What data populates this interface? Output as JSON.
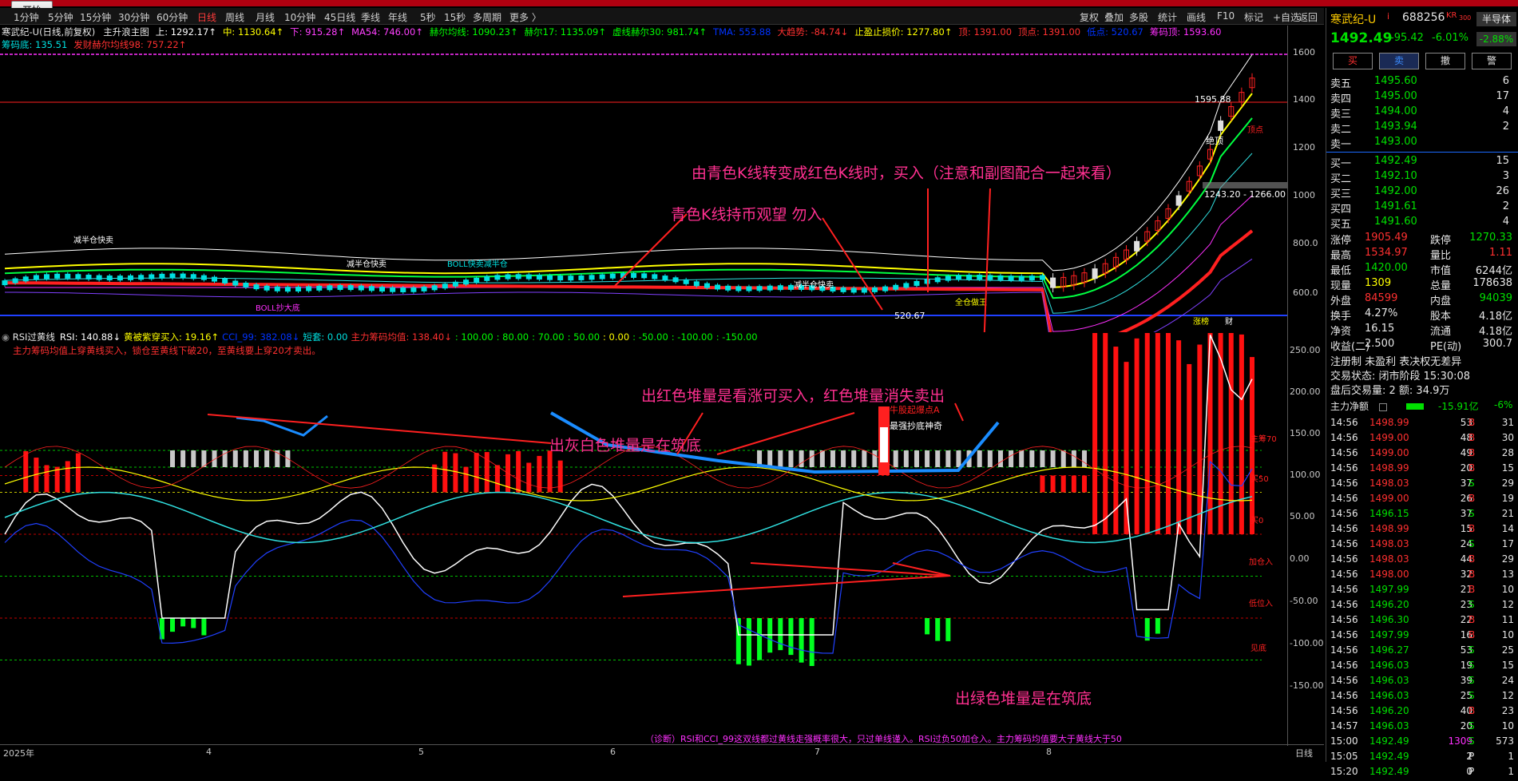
{
  "start_button": "开始",
  "periods": [
    {
      "label": "1分钟",
      "active": false
    },
    {
      "label": "5分钟",
      "active": false
    },
    {
      "label": "15分钟",
      "active": false
    },
    {
      "label": "30分钟",
      "active": false
    },
    {
      "label": "60分钟",
      "active": false
    },
    {
      "label": "日线",
      "active": true
    },
    {
      "label": "周线",
      "active": false
    },
    {
      "label": "月线",
      "active": false
    },
    {
      "label": "10分钟",
      "active": false
    },
    {
      "label": "45日线",
      "active": false
    },
    {
      "label": "季线",
      "active": false
    },
    {
      "label": "年线",
      "active": false
    },
    {
      "label": "5秒",
      "active": false
    },
    {
      "label": "15秒",
      "active": false
    },
    {
      "label": "多周期",
      "active": false
    },
    {
      "label": "更多 〉",
      "active": false
    }
  ],
  "tools": [
    "复权",
    "叠加",
    "多股",
    "统计",
    "画线",
    "F10",
    "标记",
    "+自选",
    "返回"
  ],
  "main_info": {
    "title": "寒武纪-U(日线,前复权)",
    "indicator": "主升浪主图",
    "items": [
      {
        "text": "上: 1292.17↑",
        "color": "#ffffff"
      },
      {
        "text": "中: 1130.64↑",
        "color": "#ffff00"
      },
      {
        "text": "下: 915.28↑",
        "color": "#ff40ff"
      },
      {
        "text": "MA54: 746.00↑",
        "color": "#ff40ff"
      },
      {
        "text": "赫尔均线: 1090.23↑",
        "color": "#00ff00"
      },
      {
        "text": "赫尔17: 1135.09↑",
        "color": "#00ff00"
      },
      {
        "text": "虚线赫尔30: 981.74↑",
        "color": "#00ff00"
      },
      {
        "text": "TMA: 553.88",
        "color": "#0033ff"
      },
      {
        "text": "大趋势: -84.74↓",
        "color": "#ff3030"
      },
      {
        "text": "止盈止损价: 1277.80↑",
        "color": "#ffff00"
      },
      {
        "text": "顶: 1391.00",
        "color": "#ff3030"
      },
      {
        "text": "顶点: 1391.00",
        "color": "#ff3030"
      },
      {
        "text": "低点: 520.67",
        "color": "#0033ff"
      },
      {
        "text": "筹码顶: 1593.60",
        "color": "#ff30ff"
      }
    ],
    "line2": [
      {
        "text": "筹码底: 135.51",
        "color": "#00e0e0"
      },
      {
        "text": "发财赫尔均线98: 757.22↑",
        "color": "#ff3030"
      }
    ]
  },
  "sub_info": {
    "title": "RSI过黄线",
    "items": [
      {
        "text": "RSI: 140.88↓",
        "color": "#ffffff"
      },
      {
        "text": "黄被紫穿买入: 19.16↑",
        "color": "#ffff00"
      },
      {
        "text": "CCI_99: 382.08↓",
        "color": "#0033ff"
      },
      {
        "text": "短套: 0.00",
        "color": "#00e0e0"
      },
      {
        "text": "主力筹码均值: 138.40↓",
        "color": "#ff3030"
      },
      {
        "text": ": 100.00",
        "color": "#00ff00"
      },
      {
        "text": ": 80.00",
        "color": "#00ff00"
      },
      {
        "text": ": 70.00",
        "color": "#00ff00"
      },
      {
        "text": ": 50.00",
        "color": "#00ff00"
      },
      {
        "text": ": 0.00",
        "color": "#ffff00"
      },
      {
        "text": ": -50.00",
        "color": "#00ff00"
      },
      {
        "text": ": -100.00",
        "color": "#00ff00"
      },
      {
        "text": ": -150.00",
        "color": "#00ff00"
      }
    ],
    "note": "主力筹码均值上穿黄线买入，锁仓至黄线下破20，至黄线要上穿20才卖出。"
  },
  "main_axis": [
    "1600",
    "1400",
    "1200",
    "1000",
    "800.0",
    "600.0"
  ],
  "sub_axis": [
    "250.00",
    "200.00",
    "150.00",
    "100.00",
    "50.00",
    "0.00",
    "-50.00",
    "-100.00",
    "-150.00"
  ],
  "sub_right_labels": [
    "主筹70",
    "买50",
    "买0",
    "加仓入",
    "低位入",
    "见底"
  ],
  "x_axis": [
    "2025年",
    "4",
    "5",
    "6",
    "7",
    "8"
  ],
  "x_axis_right": "日线",
  "chart_labels": {
    "top_price": "1595.88",
    "top_label": "绝顶",
    "top_point": "顶点",
    "range_box": "1243.20 - 1266.00",
    "low_price": "520.67",
    "reduce1": "减半仓快卖",
    "reduce2": "减半仓快卖",
    "reduce3": "减半仓快卖",
    "boll1": "BOLL快卖减半仓",
    "boll2": "BOLL抄大底",
    "full_buy": "全仓做王",
    "chart_tags": [
      "涨榜",
      "财"
    ],
    "sub_tag1": "牛股起爆点A",
    "sub_tag2": "最强抄底神奇"
  },
  "annotations": {
    "a1": "由青色K线转变成红色K线时，买入（注意和副图配合一起来看）",
    "a2": "青色K线持币观望 勿入",
    "a3": "出红色堆量是看涨可买入，红色堆量消失卖出",
    "a4": "出灰白色堆量是在筑底",
    "a5": "出绿色堆量是在筑底",
    "diagnosis": "（诊断）RSI和CCI_99这双线都过黄线走强概率很大，只过单线谨入。RSI过负50加仓入。主力筹码均值要大于黄线大于50"
  },
  "quote": {
    "name": "寒武纪-U",
    "name_suffix": "i",
    "code": "688256",
    "tag": "KR",
    "tag2": "300",
    "sector": "半导体",
    "price": "1492.49",
    "change": "-95.42",
    "change_pct": "-6.01%",
    "sector_pct": "-2.88%",
    "buttons": [
      "买",
      "卖",
      "撤",
      "警"
    ],
    "asks": [
      {
        "label": "卖五",
        "price": "1495.60",
        "vol": "6"
      },
      {
        "label": "卖四",
        "price": "1495.00",
        "vol": "17"
      },
      {
        "label": "卖三",
        "price": "1494.00",
        "vol": "4"
      },
      {
        "label": "卖二",
        "price": "1493.94",
        "vol": "2"
      },
      {
        "label": "卖一",
        "price": "1493.00",
        "vol": ""
      }
    ],
    "bids": [
      {
        "label": "买一",
        "price": "1492.49",
        "vol": "15"
      },
      {
        "label": "买二",
        "price": "1492.10",
        "vol": "3"
      },
      {
        "label": "买三",
        "price": "1492.00",
        "vol": "26"
      },
      {
        "label": "买四",
        "price": "1491.61",
        "vol": "2"
      },
      {
        "label": "买五",
        "price": "1491.60",
        "vol": "4"
      }
    ],
    "stats": [
      [
        "涨停",
        "1905.49",
        "跌停",
        "1270.33"
      ],
      [
        "最高",
        "1534.97",
        "量比",
        "1.11"
      ],
      [
        "最低",
        "1420.00",
        "市值",
        "6244亿"
      ],
      [
        "现量",
        "1309",
        "总量",
        "178638"
      ],
      [
        "外盘",
        "84599",
        "内盘",
        "94039"
      ],
      [
        "换手",
        "4.27%",
        "股本",
        "4.18亿"
      ],
      [
        "净资",
        "16.15",
        "流通",
        "4.18亿"
      ],
      [
        "收益(二)",
        "2.500",
        "PE(动)",
        "300.7"
      ]
    ],
    "notes": [
      "注册制 未盈利 表决权无差异",
      "交易状态: 闭市阶段 15:30:08",
      "盘后交易量: 2  额: 34.9万"
    ],
    "net_flow_label": "主力净额",
    "net_flow_value": "-15.91亿",
    "net_flow_pct": "-6%"
  },
  "ticks": [
    [
      "14:56",
      "1498.99",
      "53",
      "B",
      "31"
    ],
    [
      "14:56",
      "1499.00",
      "48",
      "B",
      "30"
    ],
    [
      "14:56",
      "1499.00",
      "49",
      "B",
      "28"
    ],
    [
      "14:56",
      "1498.99",
      "20",
      "B",
      "15"
    ],
    [
      "14:56",
      "1498.03",
      "37",
      "S",
      "29"
    ],
    [
      "14:56",
      "1499.00",
      "26",
      "B",
      "19"
    ],
    [
      "14:56",
      "1496.15",
      "37",
      "S",
      "21"
    ],
    [
      "14:56",
      "1498.99",
      "15",
      "B",
      "14"
    ],
    [
      "14:56",
      "1498.03",
      "24",
      "S",
      "17"
    ],
    [
      "14:56",
      "1498.03",
      "44",
      "B",
      "29"
    ],
    [
      "14:56",
      "1498.00",
      "32",
      "B",
      "13"
    ],
    [
      "14:56",
      "1497.99",
      "21",
      "B",
      "10"
    ],
    [
      "14:56",
      "1496.20",
      "23",
      "S",
      "12"
    ],
    [
      "14:56",
      "1496.30",
      "22",
      "B",
      "11"
    ],
    [
      "14:56",
      "1497.99",
      "16",
      "B",
      "10"
    ],
    [
      "14:56",
      "1496.27",
      "53",
      "S",
      "25"
    ],
    [
      "14:56",
      "1496.03",
      "19",
      "S",
      "15"
    ],
    [
      "14:56",
      "1496.03",
      "39",
      "S",
      "24"
    ],
    [
      "14:56",
      "1496.03",
      "25",
      "S",
      "12"
    ],
    [
      "14:56",
      "1496.20",
      "40",
      "B",
      "23"
    ],
    [
      "14:57",
      "1496.03",
      "20",
      "S",
      "10"
    ],
    [
      "15:00",
      "1492.49",
      "1309",
      "S",
      "573"
    ],
    [
      "15:05",
      "1492.49",
      "2",
      "P",
      "1"
    ],
    [
      "15:20",
      "1492.49",
      "0",
      "P",
      "1"
    ]
  ]
}
